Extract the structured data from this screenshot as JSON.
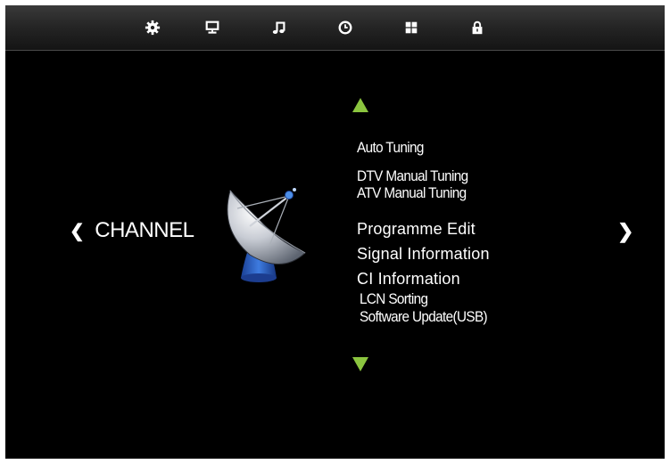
{
  "top_bar": {
    "tabs": [
      {
        "icon": "gear-icon",
        "active": false
      },
      {
        "icon": "monitor-icon",
        "active": false
      },
      {
        "icon": "music-note-icon",
        "active": false
      },
      {
        "icon": "clock-icon",
        "active": false
      },
      {
        "icon": "grid-icon",
        "active": false
      },
      {
        "icon": "lock-icon",
        "active": false
      }
    ],
    "icon_color": "#ffffff"
  },
  "main": {
    "title": "CHANNEL",
    "left_chevron": "❮",
    "right_chevron": "❯",
    "illustration": "satellite-dish-icon",
    "menu_items": [
      "Auto Tuning",
      "DTV Manual Tuning",
      "ATV Manual Tuning",
      "Programme Edit",
      "Signal Information",
      "CI Information",
      "LCN Sorting",
      "Software Update(USB)"
    ],
    "scroll_arrow_color": "#8bc53f"
  }
}
